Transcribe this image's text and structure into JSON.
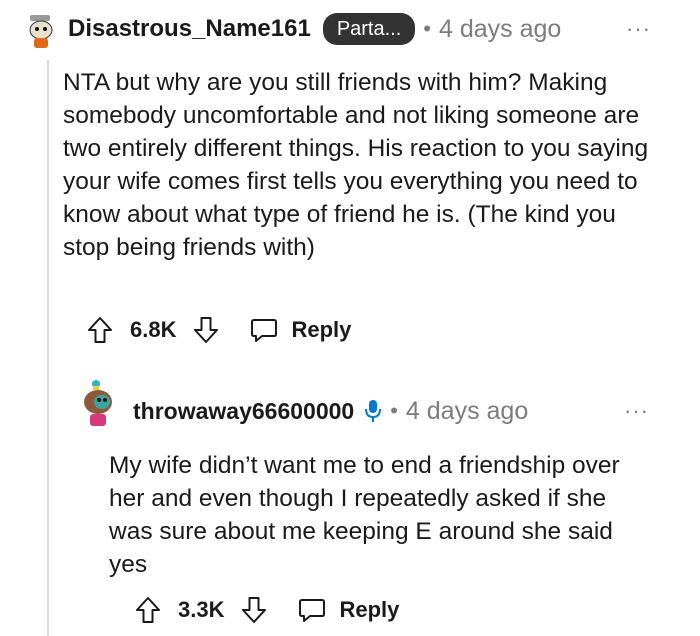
{
  "comment": {
    "username": "Disastrous_Name161",
    "flair": "Parta...",
    "separator": "•",
    "timestamp": "4 days ago",
    "more": "···",
    "body": "NTA but why are you still friends with him? Making somebody uncomfortable and not liking someone are two entirely different things. His reaction to you saying your wife comes first tells you everything you need to know about what type of friend he is. (The kind you stop being friends with)",
    "score": "6.8K",
    "reply_label": "Reply"
  },
  "reply": {
    "username": "throwaway66600000",
    "separator": "•",
    "timestamp": "4 days ago",
    "more": "···",
    "body": "My wife didn’t want me to end a friendship over her and even though I repeatedly asked if she was sure about me keeping E around she said yes",
    "score": "3.3K",
    "reply_label": "Reply"
  }
}
